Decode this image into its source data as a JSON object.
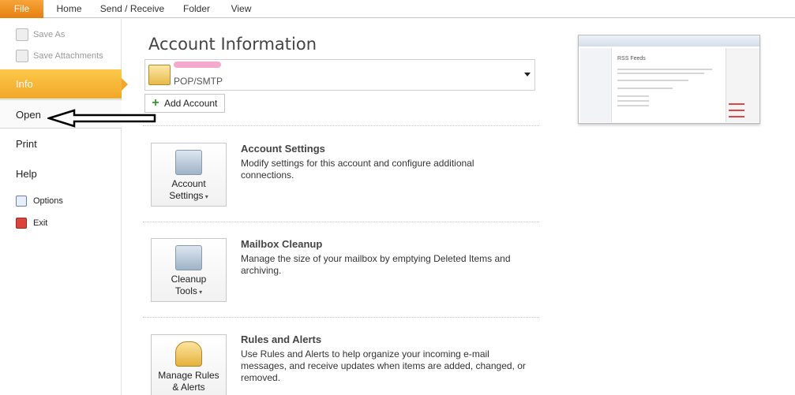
{
  "ribbon": {
    "tabs": [
      "File",
      "Home",
      "Send / Receive",
      "Folder",
      "View"
    ]
  },
  "nav": {
    "save_as": "Save As",
    "save_attachments": "Save Attachments",
    "info": "Info",
    "open": "Open",
    "print": "Print",
    "help": "Help",
    "options": "Options",
    "exit": "Exit"
  },
  "main": {
    "title": "Account Information",
    "account": {
      "type": "POP/SMTP"
    },
    "add_account": "Add Account",
    "sections": [
      {
        "tile_line1": "Account",
        "tile_line2": "Settings",
        "title": "Account Settings",
        "desc_line1": "Modify settings for this account and configure additional",
        "desc_line2": "connections."
      },
      {
        "tile_line1": "Cleanup",
        "tile_line2": "Tools",
        "title": "Mailbox Cleanup",
        "desc_line1": "Manage the size of your mailbox by emptying Deleted Items and",
        "desc_line2": "archiving."
      },
      {
        "tile_line1": "Manage Rules",
        "tile_line2": "& Alerts",
        "title": "Rules and Alerts",
        "desc_line1": "Use Rules and Alerts to help organize your incoming e-mail",
        "desc_line2": "messages, and receive updates when items are added, changed, or",
        "desc_line3": "removed."
      }
    ],
    "preview": {
      "heading": "RSS Feeds"
    }
  },
  "colors": {
    "file_tab": "#e5800f",
    "active_nav": "#f3a628"
  }
}
